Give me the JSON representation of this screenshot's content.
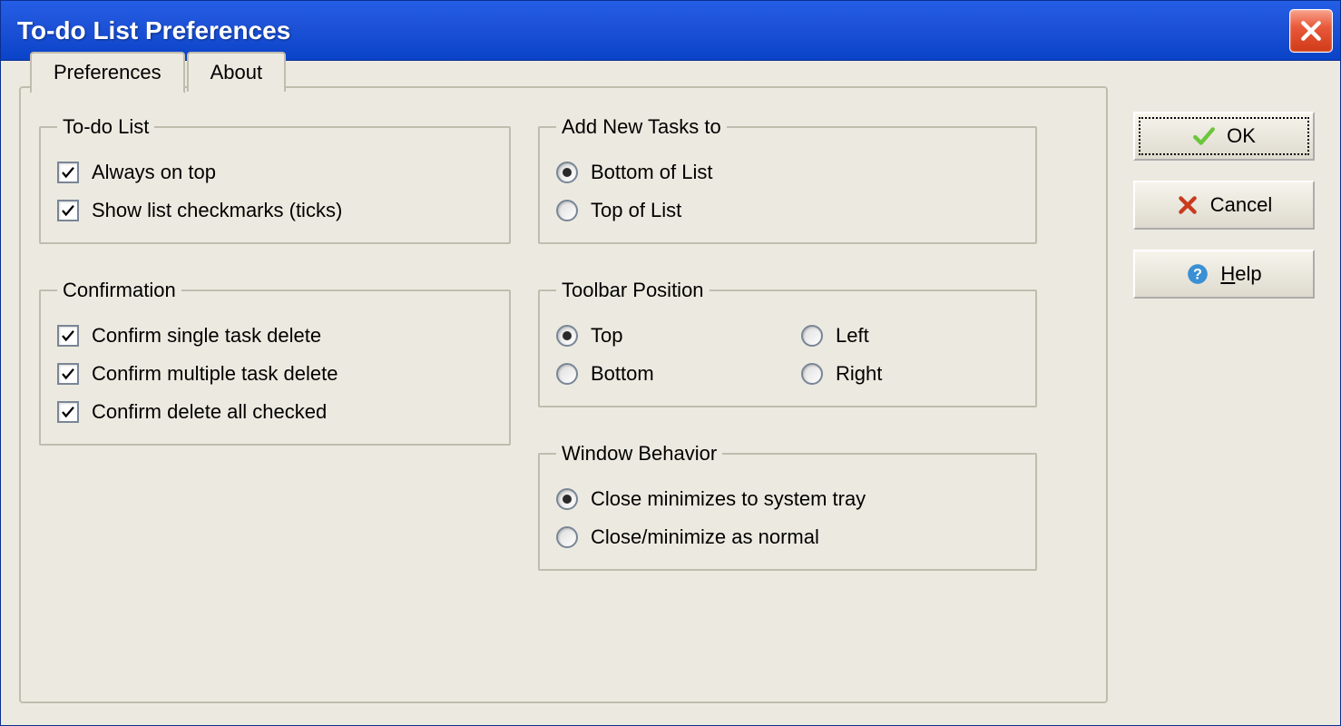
{
  "window": {
    "title": "To-do List Preferences"
  },
  "tabs": {
    "preferences": "Preferences",
    "about": "About"
  },
  "groups": {
    "todo_list": {
      "legend": "To-do List",
      "always_on_top": "Always on top",
      "show_checkmarks": "Show list checkmarks (ticks)"
    },
    "confirmation": {
      "legend": "Confirmation",
      "single_delete": "Confirm single task delete",
      "multiple_delete": "Confirm multiple task delete",
      "delete_checked": "Confirm delete all checked"
    },
    "add_new_tasks": {
      "legend": "Add New Tasks to",
      "bottom": "Bottom of List",
      "top": "Top of List"
    },
    "toolbar_position": {
      "legend": "Toolbar Position",
      "top": "Top",
      "left": "Left",
      "bottom": "Bottom",
      "right": "Right"
    },
    "window_behavior": {
      "legend": "Window Behavior",
      "minimize_tray": "Close minimizes to system tray",
      "close_normal": "Close/minimize as normal"
    }
  },
  "buttons": {
    "ok": "OK",
    "cancel": "Cancel",
    "help": "Help"
  },
  "state": {
    "active_tab": "preferences",
    "checkboxes": {
      "always_on_top": true,
      "show_checkmarks": true,
      "confirm_single_delete": true,
      "confirm_multiple_delete": true,
      "confirm_delete_checked": true
    },
    "radios": {
      "add_new_tasks": "bottom",
      "toolbar_position": "top",
      "window_behavior": "minimize_tray"
    }
  },
  "colors": {
    "titlebar_start": "#245ee6",
    "titlebar_end": "#0a43c8",
    "panel_bg": "#eceae0",
    "border": "#c0bcae",
    "close_red": "#d13a16",
    "ok_green": "#6cc63b",
    "cancel_red": "#c93a1e",
    "help_blue": "#3a90d4"
  }
}
